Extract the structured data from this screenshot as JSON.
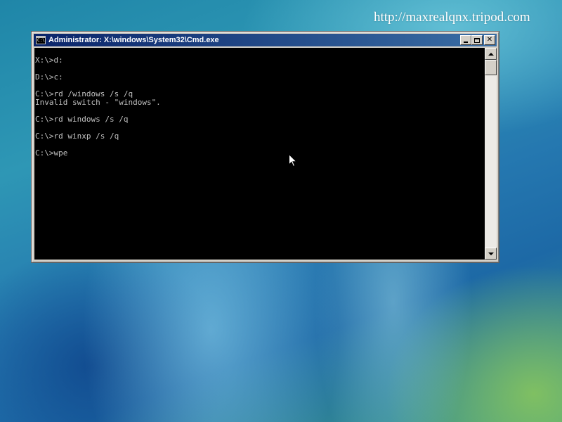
{
  "desktop": {
    "watermark": "http://maxrealqnx.tripod.com"
  },
  "window": {
    "title": "Administrator: X:\\windows\\System32\\Cmd.exe",
    "icon": "cmd-window-icon",
    "icon_text": "C:\\",
    "buttons": [
      "minimize",
      "maximize",
      "close"
    ],
    "close_glyph": "✕"
  },
  "console": {
    "lines": [
      "",
      "X:\\>d:",
      "",
      "D:\\>c:",
      "",
      "C:\\>rd /windows /s /q",
      "Invalid switch - \"windows\".",
      "",
      "C:\\>rd windows /s /q",
      "",
      "C:\\>rd winxp /s /q",
      "",
      "C:\\>wpe"
    ]
  },
  "scrollbar": {
    "position": 0
  },
  "colors": {
    "console_bg": "#000000",
    "console_text": "#c0c0c0",
    "title_bar_start": "#0a246a",
    "title_bar_end": "#3a6ea5",
    "window_frame": "#d4d0c8"
  }
}
